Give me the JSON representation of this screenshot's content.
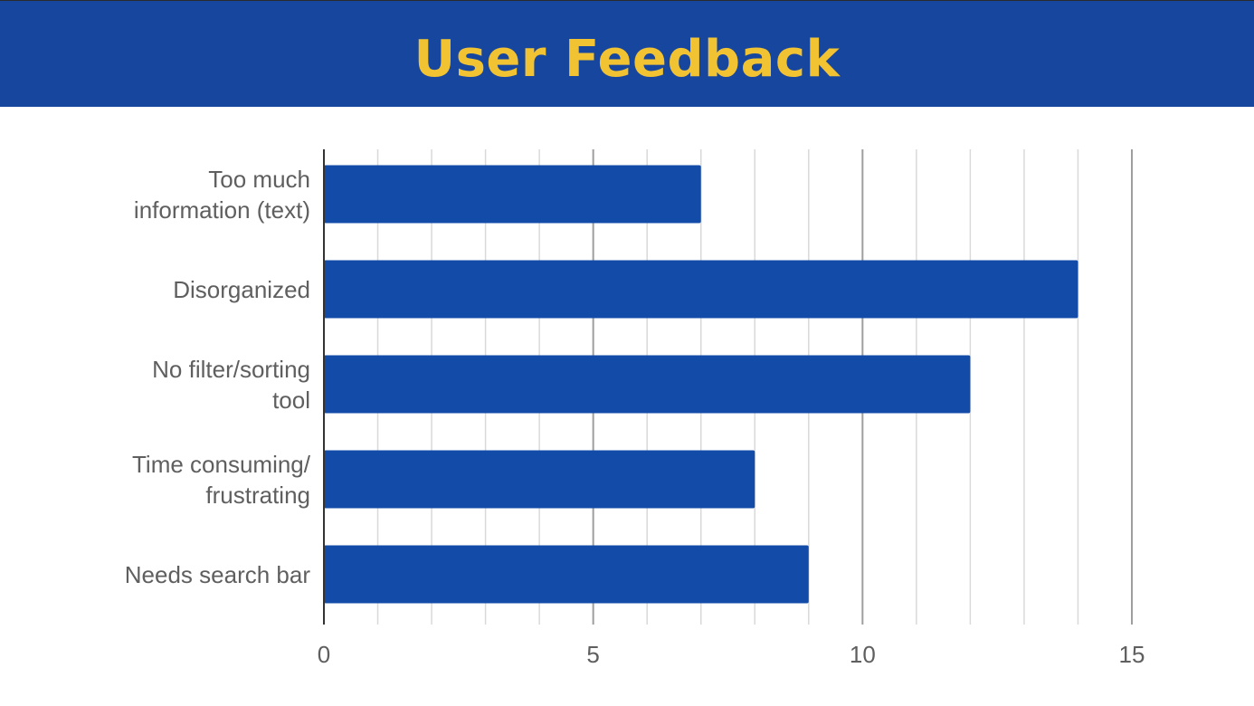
{
  "header": {
    "title": "User Feedback",
    "background": "#17469e",
    "title_color": "#f1c232"
  },
  "chart_data": {
    "type": "bar",
    "orientation": "horizontal",
    "title": "User Feedback",
    "categories": [
      "Too much information (text)",
      "Disorganized",
      "No filter/sorting tool",
      "Time consuming/ frustrating",
      "Needs search bar"
    ],
    "category_lines": [
      [
        "Too much",
        "information (text)"
      ],
      [
        "Disorganized"
      ],
      [
        "No filter/sorting",
        "tool"
      ],
      [
        "Time consuming/",
        "frustrating"
      ],
      [
        "Needs search bar"
      ]
    ],
    "values": [
      7,
      14,
      12,
      8,
      9
    ],
    "xlim": [
      0,
      15
    ],
    "x_ticks": [
      "0",
      "5",
      "10",
      "15"
    ],
    "grid": true,
    "legend": "none",
    "bar_color": "#134ba8",
    "xlabel": "",
    "ylabel": ""
  }
}
